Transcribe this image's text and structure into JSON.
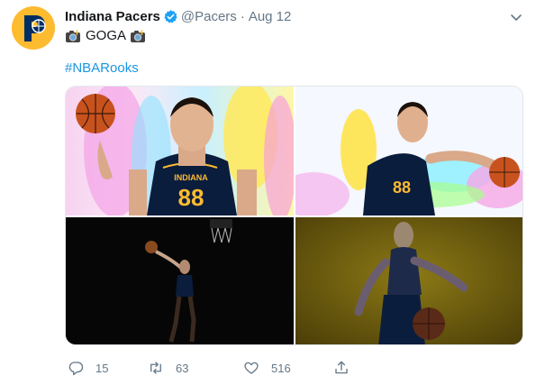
{
  "tweet": {
    "display_name": "Indiana Pacers",
    "handle": "@Pacers",
    "separator": "·",
    "date": "Aug 12",
    "line1_text": "GOGA",
    "hashtag": "#NBARooks",
    "jersey_number": "88",
    "jersey_text": "INDIANA"
  },
  "actions": {
    "reply_count": "15",
    "retweet_count": "63",
    "like_count": "516"
  },
  "colors": {
    "accent": "#1b95e0",
    "pacers_gold": "#FDBB30",
    "pacers_navy": "#002D62",
    "muted": "#657786"
  }
}
